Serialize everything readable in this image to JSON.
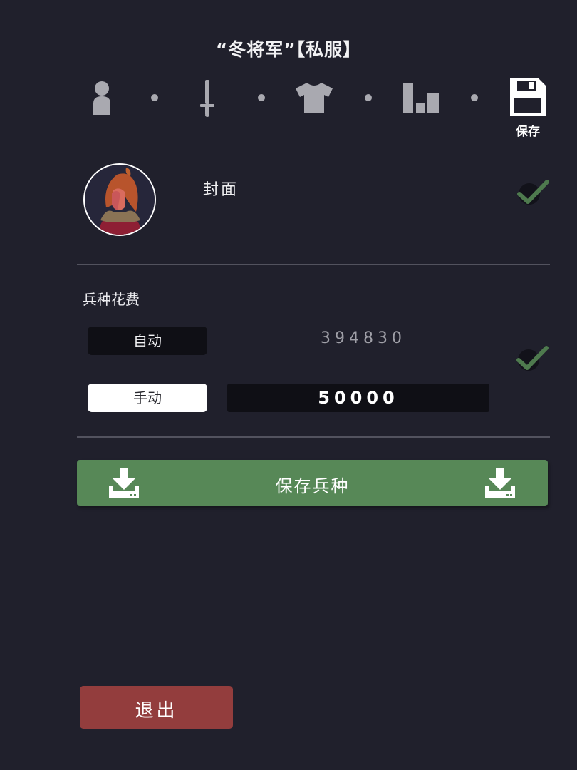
{
  "header": {
    "title": "“冬将军”【私服】"
  },
  "steps": [
    {
      "icon": "person-icon"
    },
    {
      "icon": "sword-icon"
    },
    {
      "icon": "shirt-icon"
    },
    {
      "icon": "stats-bars-icon"
    },
    {
      "icon": "floppy-disk-icon",
      "label": "保存"
    }
  ],
  "cover": {
    "label": "封面",
    "confirmed": true
  },
  "cost": {
    "heading": "兵种花费",
    "auto_label": "自动",
    "auto_value": "394830",
    "manual_label": "手动",
    "manual_value": "50000",
    "selected_mode": "手动",
    "confirmed": true
  },
  "actions": {
    "save_unit_label": "保存兵种",
    "exit_label": "退出"
  },
  "colors": {
    "background": "#20202c",
    "save_green": "#578857",
    "exit_red": "#933d3d",
    "check_green": "#4e7a4e"
  }
}
